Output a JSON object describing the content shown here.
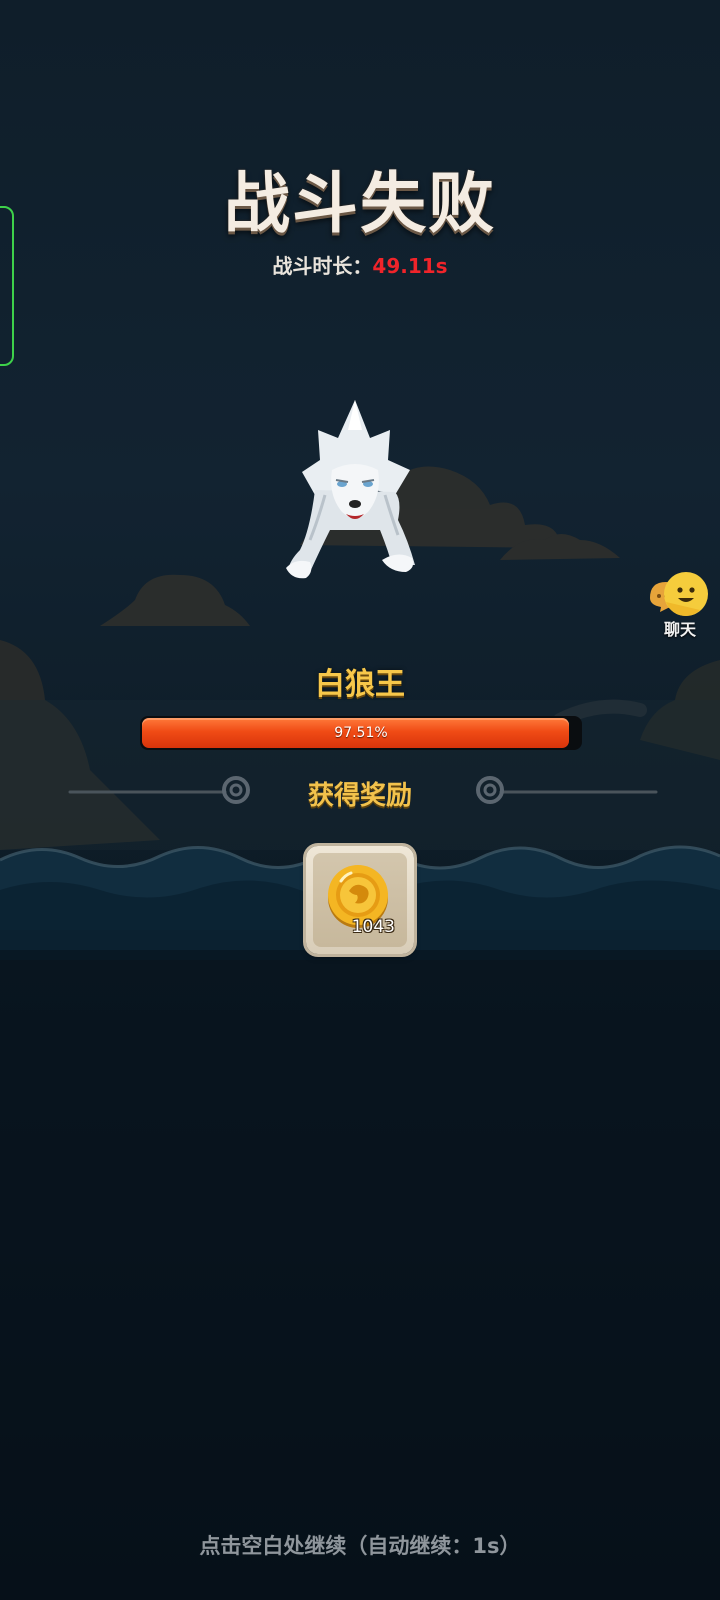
{
  "result": {
    "title": "战斗失败",
    "duration_label": "战斗时长：",
    "duration_value": "49.11s"
  },
  "boss": {
    "name": "白狼王",
    "hp_percent_text": "97.51%",
    "hp_fraction": 0.9751
  },
  "rewards": {
    "title": "获得奖励",
    "items": [
      {
        "icon": "gold-coin-icon",
        "count": "1043"
      }
    ]
  },
  "chat": {
    "label": "聊天",
    "icon": "chat-bubble-icon"
  },
  "footer": {
    "continue_hint": "点击空白处继续（自动继续：1s）"
  },
  "colors": {
    "title": "#f4ece2",
    "duration_value": "#f0242a",
    "boss_name": "#f7c74a",
    "hp_fill": "#f04b15",
    "reward_title": "#f2c24c",
    "side_panel_border": "#3ed14a"
  }
}
